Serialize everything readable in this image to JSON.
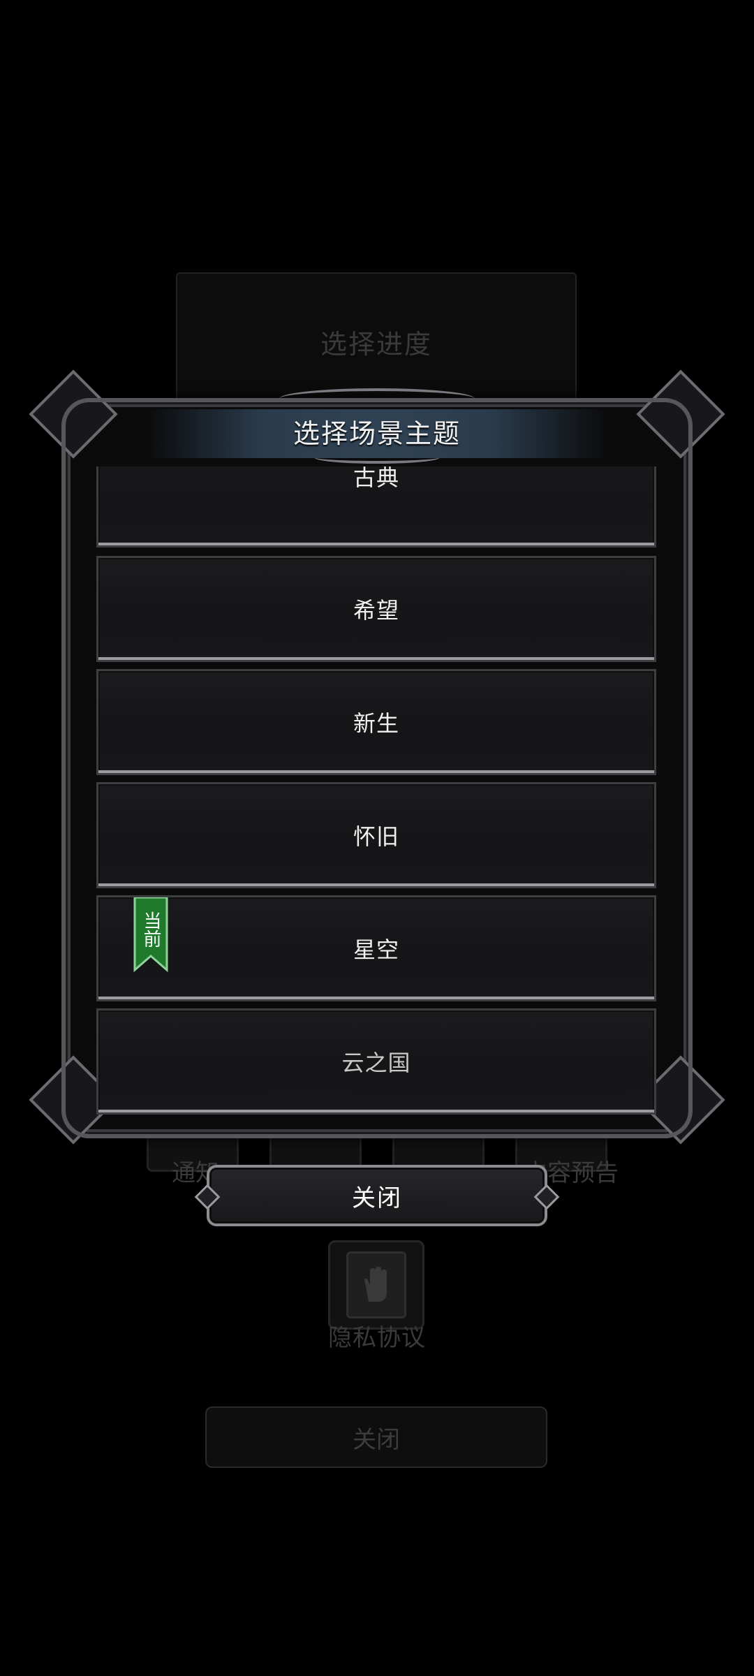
{
  "background": {
    "progress_title": "选择进度",
    "icon_row": [
      "通知",
      "",
      "",
      "内容预告"
    ],
    "privacy_label": "隐私协议",
    "close_label": "关闭"
  },
  "dialog": {
    "title": "选择场景主题",
    "current_badge": "当前",
    "items": [
      {
        "label": "古典"
      },
      {
        "label": "希望"
      },
      {
        "label": "新生"
      },
      {
        "label": "怀旧"
      },
      {
        "label": "星空",
        "current": true
      },
      {
        "label": "云之国"
      }
    ],
    "close_label": "关闭"
  },
  "colors": {
    "badge_green": "#1f7a2c",
    "header_blue": "#2f4254",
    "frame_silver": "#8b8c90"
  }
}
